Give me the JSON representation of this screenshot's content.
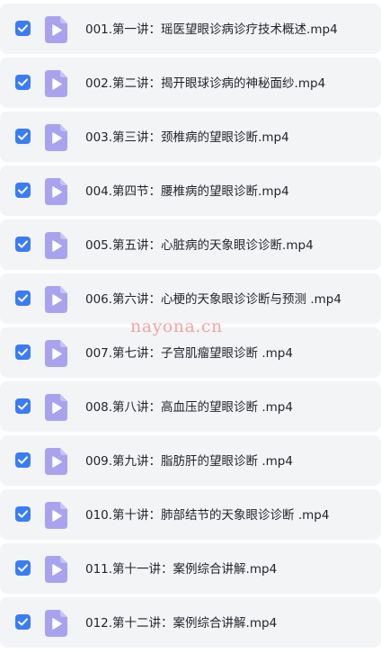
{
  "files": [
    {
      "name": "001.第一讲：瑶医望眼诊病诊疗技术概述.mp4",
      "checked": true
    },
    {
      "name": "002.第二讲：揭开眼球诊病的神秘面纱.mp4",
      "checked": true
    },
    {
      "name": "003.第三讲：颈椎病的望眼诊断.mp4",
      "checked": true
    },
    {
      "name": "004.第四节：腰椎病的望眼诊断.mp4",
      "checked": true
    },
    {
      "name": "005.第五讲：心脏病的天象眼诊诊断.mp4",
      "checked": true
    },
    {
      "name": "006.第六讲：心梗的天象眼诊诊断与预测 .mp4",
      "checked": true
    },
    {
      "name": "007.第七讲：子宫肌瘤望眼诊断 .mp4",
      "checked": true
    },
    {
      "name": "008.第八讲：高血压的望眼诊断 .mp4",
      "checked": true
    },
    {
      "name": "009.第九讲：脂肪肝的望眼诊断 .mp4",
      "checked": true
    },
    {
      "name": "010.第十讲：肺部结节的天象眼诊诊断 .mp4",
      "checked": true
    },
    {
      "name": "011.第十一讲：案例综合讲解.mp4",
      "checked": true
    },
    {
      "name": "012.第十二讲：案例综合讲解.mp4",
      "checked": true
    }
  ],
  "watermark": "nayona.cn",
  "colors": {
    "checkbox": "#3a7cf6",
    "video_icon": "#a9a3ef",
    "row_background": "#f3f4f6"
  },
  "icons": {
    "checkbox": "checkmark-icon",
    "file": "video-file-icon"
  }
}
